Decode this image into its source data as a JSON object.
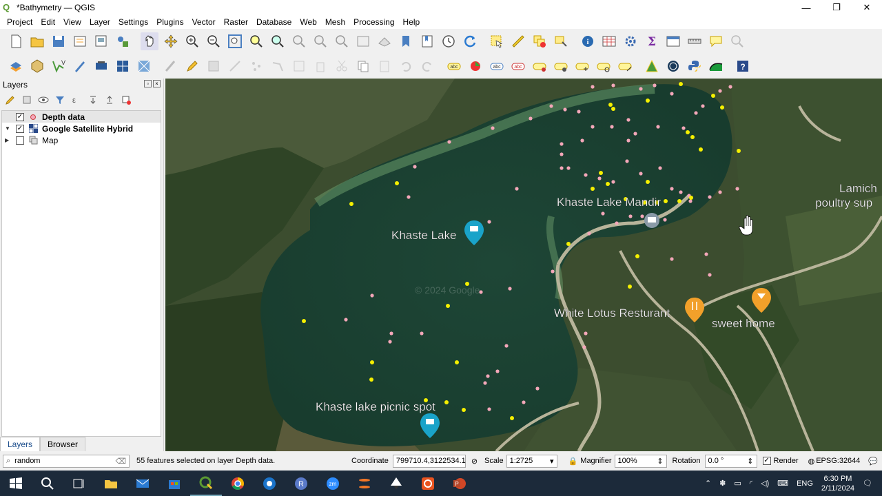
{
  "window": {
    "title": "*Bathymetry — QGIS",
    "minimize": "—",
    "restore": "❐",
    "close": "✕"
  },
  "menu": [
    "Project",
    "Edit",
    "View",
    "Layer",
    "Settings",
    "Plugins",
    "Vector",
    "Raster",
    "Database",
    "Web",
    "Mesh",
    "Processing",
    "Help"
  ],
  "layers_panel": {
    "title": "Layers",
    "layers": [
      {
        "name": "Depth data",
        "checked": true,
        "selected": true,
        "icon": "point-layer-icon"
      },
      {
        "name": "Google Satellite Hybrid",
        "checked": true,
        "selected": false,
        "icon": "raster-layer-icon"
      },
      {
        "name": "Map",
        "checked": false,
        "selected": false,
        "icon": "group-icon"
      }
    ],
    "tabs": [
      "Layers",
      "Browser"
    ]
  },
  "map": {
    "labels": {
      "khaste_lake": "Khaste Lake",
      "khaste_mandir": "Khaste Lake Mandir",
      "white_lotus": "White Lotus Resturant",
      "sweet_home": "sweet home",
      "picnic": "Khaste lake picnic spot",
      "lamich_1": "Lamich",
      "lamich_2": "poultry sup",
      "watermark": "© 2024 Google"
    }
  },
  "statusbar": {
    "search_value": "random",
    "message": "55 features selected on layer Depth data.",
    "coordinate_label": "Coordinate",
    "coordinate_value": "799710.4,3122534.1",
    "scale_label": "Scale",
    "scale_value": "1:2725",
    "magnifier_label": "Magnifier",
    "magnifier_value": "100%",
    "rotation_label": "Rotation",
    "rotation_value": "0.0 °",
    "render_label": "Render",
    "crs": "EPSG:32644"
  },
  "taskbar": {
    "time": "6:30 PM",
    "date": "2/11/2024",
    "lang": "ENG"
  },
  "colors": {
    "pink_point": "#f4a7b9",
    "yellow_point": "#f5f000",
    "lake": "#1f4a3a",
    "accent": "#1a4c8b"
  }
}
